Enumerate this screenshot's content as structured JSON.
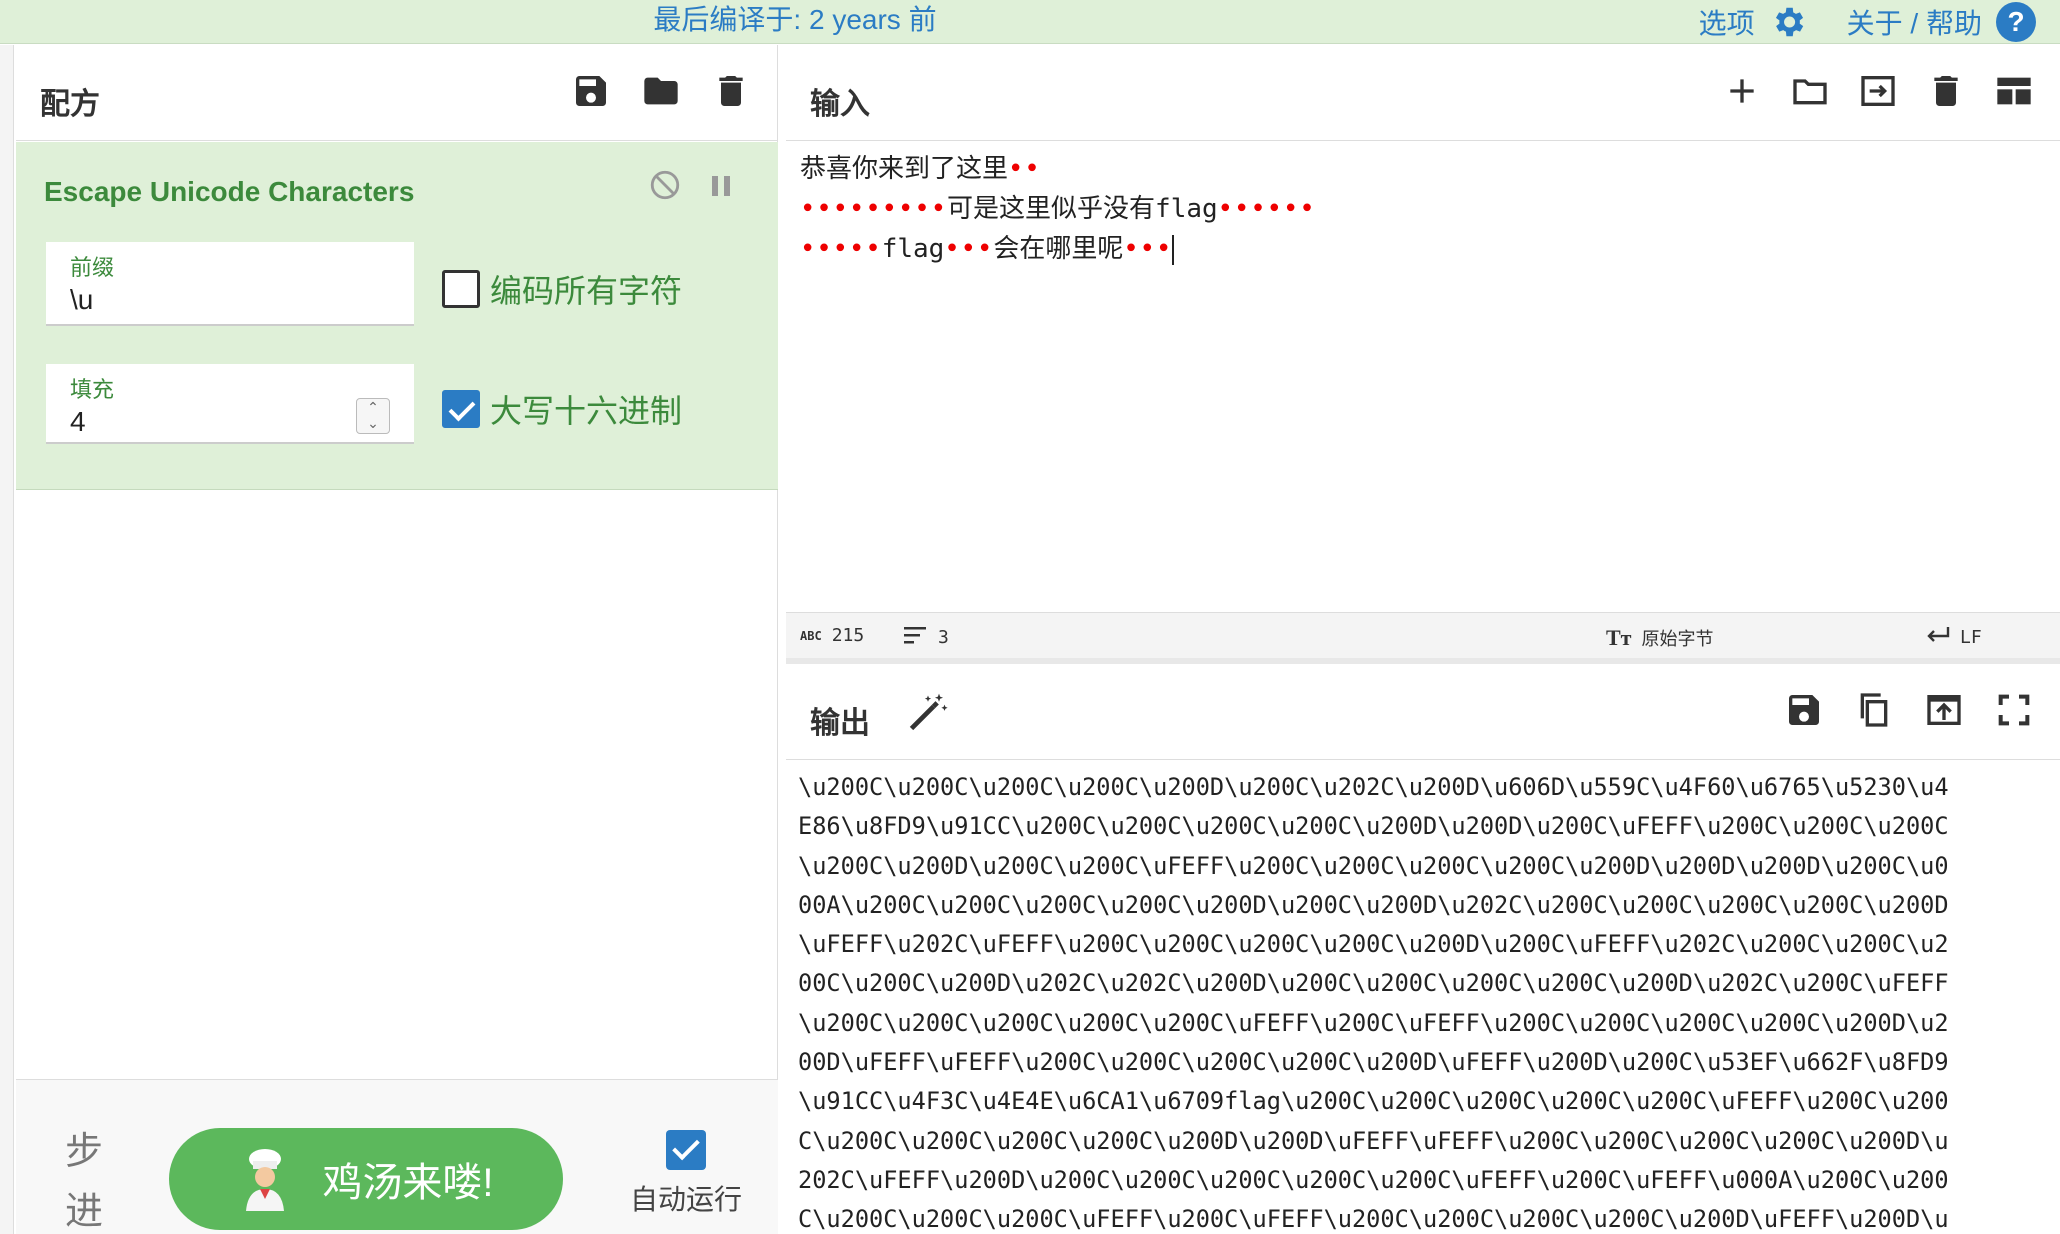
{
  "banner": {
    "last_build": "最后编译于: 2 years 前",
    "options": "选项",
    "about": "关于 / 帮助"
  },
  "recipe": {
    "title": "配方",
    "operation": {
      "name": "Escape Unicode Characters",
      "prefix_label": "前缀",
      "prefix_value": "\\u",
      "encode_all_label": "编码所有字符",
      "encode_all_checked": false,
      "padding_label": "填充",
      "padding_value": "4",
      "uppercase_label": "大写十六进制",
      "uppercase_checked": true
    },
    "controls": {
      "step_label": "步\n进",
      "bake_label": "鸡汤来喽!",
      "autobake_label": "自动运行",
      "autobake_checked": true
    }
  },
  "input": {
    "title": "输入",
    "line1_text": "恭喜你来到了这里",
    "line1_dots": "••",
    "line2_dots_a": "•••••••••",
    "line2_text": "可是这里似乎没有",
    "line2_flag": "flag",
    "line2_dots_b": "••••••",
    "line3_dots_a": "•••••",
    "line3_flag": "flag",
    "line3_dots_b": "•••",
    "line3_text": "会在哪里呢",
    "line3_dots_c": "•••",
    "status": {
      "abc_label": "ABC",
      "length": "215",
      "lines": "3",
      "encoding": "原始字节",
      "eol": "LF"
    }
  },
  "output": {
    "title": "输出",
    "lines": [
      "\\u200C\\u200C\\u200C\\u200C\\u200D\\u200C\\u202C\\u200D\\u606D\\u559C\\u4F60\\u6765\\u5230\\u4",
      "E86\\u8FD9\\u91CC\\u200C\\u200C\\u200C\\u200C\\u200D\\u200D\\u200C\\uFEFF\\u200C\\u200C\\u200C",
      "\\u200C\\u200D\\u200C\\u200C\\uFEFF\\u200C\\u200C\\u200C\\u200C\\u200D\\u200D\\u200D\\u200C\\u0",
      "00A\\u200C\\u200C\\u200C\\u200C\\u200D\\u200C\\u200D\\u202C\\u200C\\u200C\\u200C\\u200C\\u200D",
      "\\uFEFF\\u202C\\uFEFF\\u200C\\u200C\\u200C\\u200C\\u200D\\u200C\\uFEFF\\u202C\\u200C\\u200C\\u2",
      "00C\\u200C\\u200D\\u202C\\u202C\\u200D\\u200C\\u200C\\u200C\\u200C\\u200D\\u202C\\u200C\\uFEFF",
      "\\u200C\\u200C\\u200C\\u200C\\u200C\\uFEFF\\u200C\\uFEFF\\u200C\\u200C\\u200C\\u200C\\u200D\\u2",
      "00D\\uFEFF\\uFEFF\\u200C\\u200C\\u200C\\u200C\\u200D\\uFEFF\\u200D\\u200C\\u53EF\\u662F\\u8FD9",
      "\\u91CC\\u4F3C\\u4E4E\\u6CA1\\u6709flag\\u200C\\u200C\\u200C\\u200C\\u200C\\uFEFF\\u200C\\u200",
      "C\\u200C\\u200C\\u200C\\u200C\\u200D\\u200D\\uFEFF\\uFEFF\\u200C\\u200C\\u200C\\u200C\\u200D\\u",
      "202C\\uFEFF\\u200D\\u200C\\u200C\\u200C\\u200C\\u200C\\uFEFF\\u200C\\uFEFF\\u000A\\u200C\\u200",
      "C\\u200C\\u200C\\u200C\\uFEFF\\u200C\\uFEFF\\u200C\\u200C\\u200C\\u200C\\u200D\\uFEFF\\u200D\\u"
    ]
  },
  "colors": {
    "banner_bg": "#dff0d8",
    "link": "#2b7cc4",
    "op_green": "#3c8a3c",
    "bake_green": "#5cb85c"
  }
}
